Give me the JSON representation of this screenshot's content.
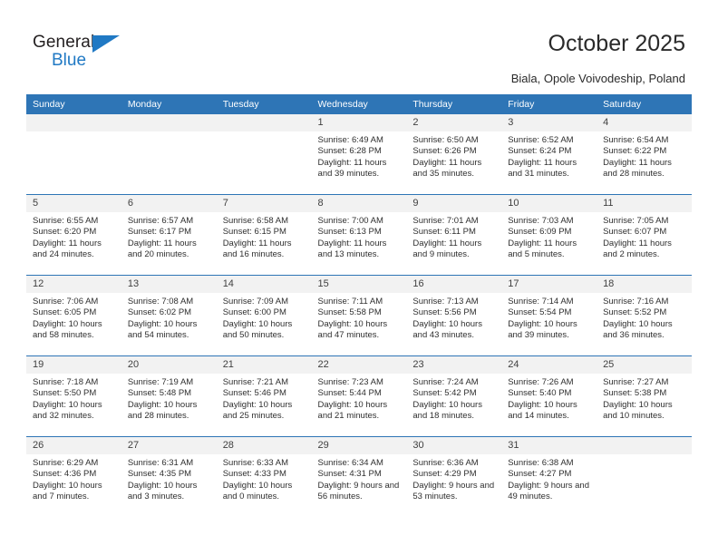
{
  "brand": {
    "name_top": "General",
    "name_bottom": "Blue",
    "triangle_color": "#2079c4",
    "text_color": "#231f20"
  },
  "header": {
    "title": "October 2025",
    "subtitle": "Biala, Opole Voivodeship, Poland"
  },
  "theme": {
    "accent": "#2e75b6",
    "daynum_background": "#f2f2f2",
    "text": "#2f2f2f"
  },
  "calendar": {
    "weekday_headers": [
      "Sunday",
      "Monday",
      "Tuesday",
      "Wednesday",
      "Thursday",
      "Friday",
      "Saturday"
    ],
    "weeks": [
      [
        {
          "day": "",
          "lines": []
        },
        {
          "day": "",
          "lines": []
        },
        {
          "day": "",
          "lines": []
        },
        {
          "day": "1",
          "lines": [
            "Sunrise: 6:49 AM",
            "Sunset: 6:28 PM",
            "Daylight: 11 hours and 39 minutes."
          ]
        },
        {
          "day": "2",
          "lines": [
            "Sunrise: 6:50 AM",
            "Sunset: 6:26 PM",
            "Daylight: 11 hours and 35 minutes."
          ]
        },
        {
          "day": "3",
          "lines": [
            "Sunrise: 6:52 AM",
            "Sunset: 6:24 PM",
            "Daylight: 11 hours and 31 minutes."
          ]
        },
        {
          "day": "4",
          "lines": [
            "Sunrise: 6:54 AM",
            "Sunset: 6:22 PM",
            "Daylight: 11 hours and 28 minutes."
          ]
        }
      ],
      [
        {
          "day": "5",
          "lines": [
            "Sunrise: 6:55 AM",
            "Sunset: 6:20 PM",
            "Daylight: 11 hours and 24 minutes."
          ]
        },
        {
          "day": "6",
          "lines": [
            "Sunrise: 6:57 AM",
            "Sunset: 6:17 PM",
            "Daylight: 11 hours and 20 minutes."
          ]
        },
        {
          "day": "7",
          "lines": [
            "Sunrise: 6:58 AM",
            "Sunset: 6:15 PM",
            "Daylight: 11 hours and 16 minutes."
          ]
        },
        {
          "day": "8",
          "lines": [
            "Sunrise: 7:00 AM",
            "Sunset: 6:13 PM",
            "Daylight: 11 hours and 13 minutes."
          ]
        },
        {
          "day": "9",
          "lines": [
            "Sunrise: 7:01 AM",
            "Sunset: 6:11 PM",
            "Daylight: 11 hours and 9 minutes."
          ]
        },
        {
          "day": "10",
          "lines": [
            "Sunrise: 7:03 AM",
            "Sunset: 6:09 PM",
            "Daylight: 11 hours and 5 minutes."
          ]
        },
        {
          "day": "11",
          "lines": [
            "Sunrise: 7:05 AM",
            "Sunset: 6:07 PM",
            "Daylight: 11 hours and 2 minutes."
          ]
        }
      ],
      [
        {
          "day": "12",
          "lines": [
            "Sunrise: 7:06 AM",
            "Sunset: 6:05 PM",
            "Daylight: 10 hours and 58 minutes."
          ]
        },
        {
          "day": "13",
          "lines": [
            "Sunrise: 7:08 AM",
            "Sunset: 6:02 PM",
            "Daylight: 10 hours and 54 minutes."
          ]
        },
        {
          "day": "14",
          "lines": [
            "Sunrise: 7:09 AM",
            "Sunset: 6:00 PM",
            "Daylight: 10 hours and 50 minutes."
          ]
        },
        {
          "day": "15",
          "lines": [
            "Sunrise: 7:11 AM",
            "Sunset: 5:58 PM",
            "Daylight: 10 hours and 47 minutes."
          ]
        },
        {
          "day": "16",
          "lines": [
            "Sunrise: 7:13 AM",
            "Sunset: 5:56 PM",
            "Daylight: 10 hours and 43 minutes."
          ]
        },
        {
          "day": "17",
          "lines": [
            "Sunrise: 7:14 AM",
            "Sunset: 5:54 PM",
            "Daylight: 10 hours and 39 minutes."
          ]
        },
        {
          "day": "18",
          "lines": [
            "Sunrise: 7:16 AM",
            "Sunset: 5:52 PM",
            "Daylight: 10 hours and 36 minutes."
          ]
        }
      ],
      [
        {
          "day": "19",
          "lines": [
            "Sunrise: 7:18 AM",
            "Sunset: 5:50 PM",
            "Daylight: 10 hours and 32 minutes."
          ]
        },
        {
          "day": "20",
          "lines": [
            "Sunrise: 7:19 AM",
            "Sunset: 5:48 PM",
            "Daylight: 10 hours and 28 minutes."
          ]
        },
        {
          "day": "21",
          "lines": [
            "Sunrise: 7:21 AM",
            "Sunset: 5:46 PM",
            "Daylight: 10 hours and 25 minutes."
          ]
        },
        {
          "day": "22",
          "lines": [
            "Sunrise: 7:23 AM",
            "Sunset: 5:44 PM",
            "Daylight: 10 hours and 21 minutes."
          ]
        },
        {
          "day": "23",
          "lines": [
            "Sunrise: 7:24 AM",
            "Sunset: 5:42 PM",
            "Daylight: 10 hours and 18 minutes."
          ]
        },
        {
          "day": "24",
          "lines": [
            "Sunrise: 7:26 AM",
            "Sunset: 5:40 PM",
            "Daylight: 10 hours and 14 minutes."
          ]
        },
        {
          "day": "25",
          "lines": [
            "Sunrise: 7:27 AM",
            "Sunset: 5:38 PM",
            "Daylight: 10 hours and 10 minutes."
          ]
        }
      ],
      [
        {
          "day": "26",
          "lines": [
            "Sunrise: 6:29 AM",
            "Sunset: 4:36 PM",
            "Daylight: 10 hours and 7 minutes."
          ]
        },
        {
          "day": "27",
          "lines": [
            "Sunrise: 6:31 AM",
            "Sunset: 4:35 PM",
            "Daylight: 10 hours and 3 minutes."
          ]
        },
        {
          "day": "28",
          "lines": [
            "Sunrise: 6:33 AM",
            "Sunset: 4:33 PM",
            "Daylight: 10 hours and 0 minutes."
          ]
        },
        {
          "day": "29",
          "lines": [
            "Sunrise: 6:34 AM",
            "Sunset: 4:31 PM",
            "Daylight: 9 hours and 56 minutes."
          ]
        },
        {
          "day": "30",
          "lines": [
            "Sunrise: 6:36 AM",
            "Sunset: 4:29 PM",
            "Daylight: 9 hours and 53 minutes."
          ]
        },
        {
          "day": "31",
          "lines": [
            "Sunrise: 6:38 AM",
            "Sunset: 4:27 PM",
            "Daylight: 9 hours and 49 minutes."
          ]
        },
        {
          "day": "",
          "lines": []
        }
      ]
    ]
  }
}
